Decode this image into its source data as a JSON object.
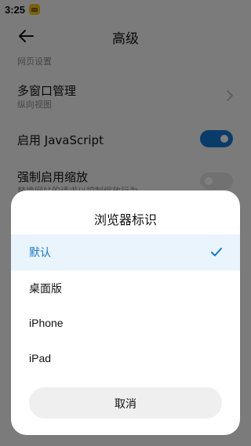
{
  "status_bar": {
    "time": "3:25"
  },
  "header": {
    "title": "高级"
  },
  "settings": {
    "section_label": "网页设置",
    "multiwindow": {
      "label": "多窗口管理",
      "value": "纵向视图"
    },
    "javascript": {
      "label": "启用 JavaScript",
      "enabled": true
    },
    "zoom": {
      "label": "强制启用缩放",
      "description": "替换网站的请求以控制缩放行为",
      "enabled": false
    }
  },
  "dialog": {
    "title": "浏览器标识",
    "options": [
      {
        "label": "默认",
        "selected": true
      },
      {
        "label": "桌面版",
        "selected": false
      },
      {
        "label": "iPhone",
        "selected": false
      },
      {
        "label": "iPad",
        "selected": false
      }
    ],
    "cancel_label": "取消"
  },
  "colors": {
    "accent": "#1478d4",
    "toggle_on": "#1478d4",
    "toggle_off": "#e3e3e3",
    "selected_bg": "#eaf4fd"
  }
}
